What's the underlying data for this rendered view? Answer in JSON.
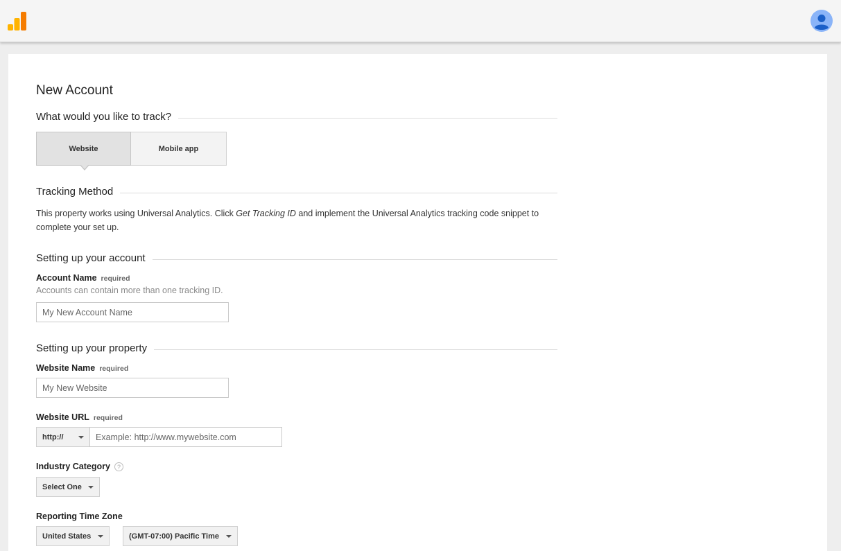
{
  "header": {
    "logo_icon": "google-analytics-logo-icon",
    "avatar_icon": "user-avatar-icon"
  },
  "page": {
    "title": "New Account"
  },
  "track": {
    "heading": "What would you like to track?",
    "options": [
      "Website",
      "Mobile app"
    ],
    "selected": "Website"
  },
  "tracking_method": {
    "heading": "Tracking Method",
    "text_before": "This property works using Universal Analytics. Click ",
    "text_link": "Get Tracking ID",
    "text_after": " and implement the Universal Analytics tracking code snippet to complete your set up."
  },
  "account": {
    "heading": "Setting up your account",
    "name_label": "Account Name",
    "required": "required",
    "hint": "Accounts can contain more than one tracking ID.",
    "name_placeholder": "My New Account Name"
  },
  "property": {
    "heading": "Setting up your property",
    "website_name_label": "Website Name",
    "website_name_placeholder": "My New Website",
    "url_label": "Website URL",
    "protocol": "http://",
    "url_placeholder": "Example: http://www.mywebsite.com",
    "industry_label": "Industry Category",
    "industry_help_icon": "question-help-icon",
    "industry_value": "Select One",
    "timezone_label": "Reporting Time Zone",
    "country_value": "United States",
    "timezone_value": "(GMT-07:00) Pacific Time"
  }
}
